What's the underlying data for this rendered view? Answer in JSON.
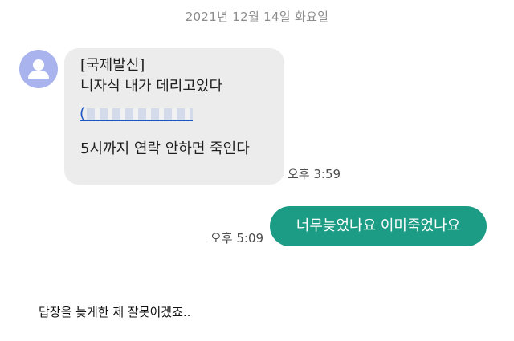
{
  "date_header": "2021년 12월 14일 화요일",
  "incoming": {
    "sender_icon": "person-avatar-icon",
    "line1": "[국제발신]",
    "line2": "니자식 내가 데리고있다",
    "link_prefix": "(",
    "line_last_prefix": "5",
    "line_last_underlined": "시",
    "line_last_rest": "까지 연락 안하면 죽인다",
    "time": "오후 3:59"
  },
  "outgoing": {
    "text": "너무늦었나요 이미죽었나요",
    "time": "오후 5:09"
  },
  "caption": "답장을 늦게한 제 잘못이겠죠..",
  "colors": {
    "incoming_bubble": "#ececec",
    "outgoing_bubble": "#1d9c85",
    "avatar": "#a9b3ee",
    "link": "#1c55c8"
  }
}
